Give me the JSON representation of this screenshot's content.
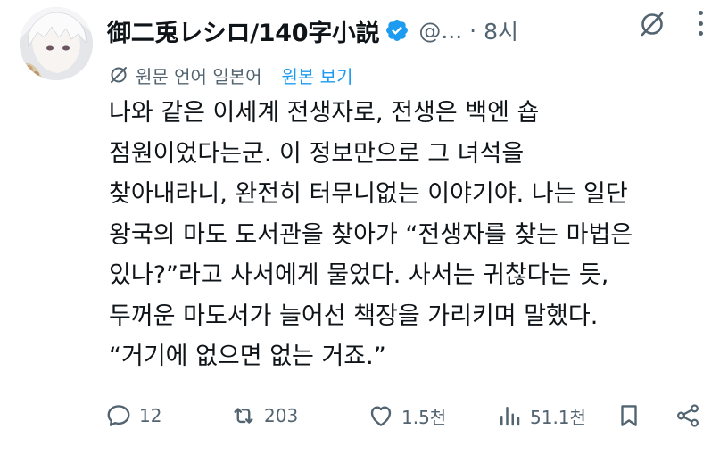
{
  "tweet": {
    "author_name": "御二兎レシロ/140字小説",
    "handle": "@...",
    "separator": "·",
    "time": "8시",
    "translation_note": "원문 언어 일본어",
    "show_original": "원본 보기",
    "body_lines": [
      "나와 같은 이세계 전생자로, 전생은 백엔 숍",
      "점원이었다는군. 이 정보만으로 그 녀석을",
      "찾아내라니, 완전히 터무니없는 이야기야. 나는 일단",
      "왕국의 마도 도서관을 찾아가 “전생자를 찾는 마법은",
      "있나?”라고 사서에게 물었다. 사서는 귀찮다는 듯,",
      "두꺼운 마도서가 늘어선 책장을 가리키며 말했다.",
      "“거기에 없으면 없는 거죠.”"
    ]
  },
  "actions": {
    "replies": "12",
    "retweets": "203",
    "likes": "1.5천",
    "views": "51.1천"
  },
  "colors": {
    "text": "#0f1419",
    "muted": "#536471",
    "accent": "#1d9bf0"
  },
  "icons": [
    "verified-badge-icon",
    "grok-icon",
    "more-icon",
    "translate-icon",
    "reply-icon",
    "retweet-icon",
    "like-icon",
    "views-icon",
    "bookmark-icon",
    "share-icon"
  ]
}
